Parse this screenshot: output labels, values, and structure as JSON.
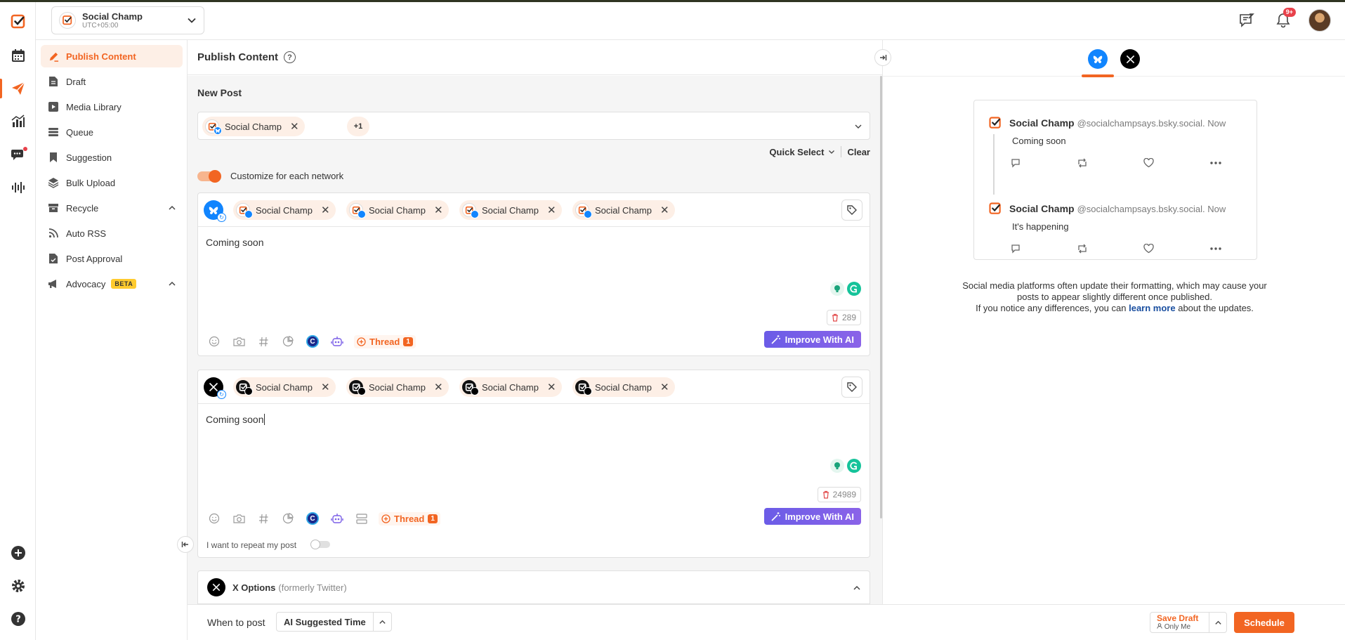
{
  "account": {
    "name": "Social Champ",
    "timezone": "UTC+05:00"
  },
  "header": {
    "notification_count": "9+"
  },
  "colors": {
    "brand": "#f26522",
    "bluesky": "#1185fe",
    "x": "#000000",
    "ai_button": "#7b5fe7"
  },
  "sidebar": {
    "items": [
      {
        "label": "Publish Content",
        "icon": "pen-icon"
      },
      {
        "label": "Draft",
        "icon": "document-icon"
      },
      {
        "label": "Media Library",
        "icon": "media-icon"
      },
      {
        "label": "Queue",
        "icon": "queue-icon"
      },
      {
        "label": "Suggestion",
        "icon": "bookmark-icon"
      },
      {
        "label": "Bulk Upload",
        "icon": "layers-icon"
      },
      {
        "label": "Recycle",
        "icon": "archive-icon"
      },
      {
        "label": "Auto RSS",
        "icon": "rss-icon"
      },
      {
        "label": "Post Approval",
        "icon": "approval-icon"
      },
      {
        "label": "Advocacy",
        "icon": "megaphone-icon",
        "badge": "BETA"
      }
    ]
  },
  "main": {
    "title": "Publish Content",
    "new_post_label": "New Post",
    "selected_account": "Social Champ",
    "more_count": "+1",
    "quick_select": "Quick Select",
    "clear": "Clear",
    "customize_label": "Customize for each network",
    "editors": [
      {
        "network": "bluesky",
        "chips": [
          "Social Champ",
          "Social Champ",
          "Social Champ",
          "Social Champ"
        ],
        "text": "Coming soon",
        "char_count": "289",
        "thread_label": "Thread",
        "thread_count": "1",
        "improve_label": "Improve With AI"
      },
      {
        "network": "x",
        "chips": [
          "Social Champ",
          "Social Champ",
          "Social Champ",
          "Social Champ"
        ],
        "text": "Coming soon",
        "char_count": "24989",
        "thread_label": "Thread",
        "thread_count": "1",
        "improve_label": "Improve With AI"
      }
    ],
    "repeat_label": "I want to repeat my post",
    "x_options_title": "X Options",
    "x_options_sub": "(formerly Twitter)"
  },
  "bottom": {
    "when_label": "When to post",
    "when_value": "AI Suggested Time",
    "save_draft": "Save Draft",
    "save_draft_sub": "Only Me",
    "schedule": "Schedule"
  },
  "preview": {
    "posts": [
      {
        "name": "Social Champ",
        "handle": "@socialchampsays.bsky.social. Now",
        "text": "Coming soon"
      },
      {
        "name": "Social Champ",
        "handle": "@socialchampsays.bsky.social. Now",
        "text": "It's happening"
      }
    ],
    "note_line1": "Social media platforms often update their formatting, which may cause your",
    "note_line2": "posts to appear slightly different once published.",
    "note_line3_pre": "If you notice any differences, you can",
    "note_link": "learn more",
    "note_line3_post": "about the updates."
  }
}
